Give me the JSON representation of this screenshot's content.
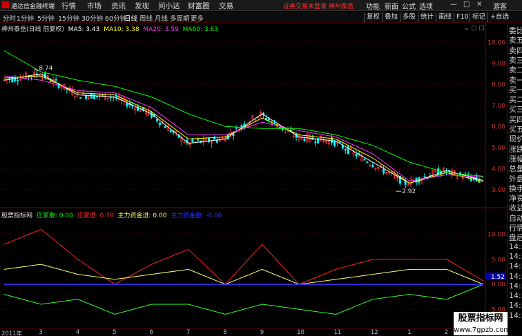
{
  "menubar": {
    "app_title": "通达信金融终端",
    "items": [
      "行情",
      "市场",
      "资讯",
      "发现",
      "问小达",
      "财富圈",
      "交易"
    ],
    "notice": "证券交易未登录  神州泰岳",
    "right_items": [
      "功能",
      "新面",
      "公式",
      "选项"
    ],
    "user": "游客"
  },
  "toolbar": {
    "periods": [
      "分时",
      "1分钟",
      "5分钟",
      "15分钟",
      "30分钟",
      "60分钟",
      "日线",
      "周线",
      "月线",
      "多周期",
      "更多"
    ],
    "active_period": "日线",
    "buttons": [
      "复权",
      "叠加",
      "多股",
      "统计",
      "画线",
      "F10",
      "标记",
      "+自选"
    ]
  },
  "kline": {
    "title": "神州泰岳(日线 前复权)",
    "ma": [
      {
        "label": "MA5: 3.43",
        "color": "#ffffff"
      },
      {
        "label": "MA10: 3.38",
        "color": "#ffff00"
      },
      {
        "label": "MA20: 3.59",
        "color": "#ff33ff"
      },
      {
        "label": "MA60: 3.63",
        "color": "#00ff00"
      }
    ],
    "high_label": "8.74",
    "low_label": "2.92",
    "y_labels": [
      "10.00",
      "9.00",
      "8.00",
      "7.00",
      "6.00",
      "5.00",
      "4.00",
      "3.00"
    ]
  },
  "indicator": {
    "title": "股票指标网",
    "items": [
      {
        "label": "庄家散: 0.00",
        "color": "#00ff00"
      },
      {
        "label": "庄家进: 0.70",
        "color": "#ff3333"
      },
      {
        "label": "主力资金进: 0.00",
        "color": "#ffff66"
      },
      {
        "label": "主力资金散: -0.06",
        "color": "#3333ff"
      }
    ],
    "y_labels": [
      "10.00",
      "5.00",
      "0.00",
      "-5.00"
    ],
    "current_value": "1.52"
  },
  "right_panel": [
    "委比",
    "卖五",
    "卖四",
    "卖三",
    "卖二",
    "卖一",
    "买一",
    "买二",
    "买三",
    "买四",
    "买五",
    "现价",
    "涨跌",
    "涨幅",
    "总量",
    "外盘",
    "换手",
    "净资",
    "收益",
    "自动",
    "行情",
    "盘后",
    "14:56",
    "14:56",
    "14:56",
    "14:56",
    "14:56",
    "14:56",
    "14:56",
    "14:56"
  ],
  "x_axis": [
    "2011年",
    "3",
    "4",
    "5",
    "6",
    "7",
    "8",
    "9",
    "10",
    "11",
    "12",
    "1",
    "2",
    "3"
  ],
  "watermark": {
    "title": "股票指标网",
    "url": "www.7gpzb.com"
  },
  "colors": {
    "up": "#ff3333",
    "down": "#00ffff",
    "ma5": "#ffffff",
    "ma10": "#ffff00",
    "ma20": "#ff33ff",
    "ma60": "#00ff00",
    "ind_red": "#ff2222",
    "ind_green": "#33ff33",
    "ind_yellow": "#ffff66",
    "ind_blue": "#3333ff"
  },
  "chart_data": [
    {
      "type": "line",
      "title": "神州泰岳(日线 前复权)",
      "ylim": [
        2.5,
        10.5
      ],
      "y_ticks": [
        10,
        9,
        8,
        7,
        6,
        5,
        4,
        3
      ],
      "x": [
        "2011年",
        "3",
        "4",
        "5",
        "6",
        "7",
        "8",
        "9",
        "10",
        "11",
        "12",
        "1",
        "2",
        "3"
      ],
      "series": [
        {
          "name": "MA5",
          "values": [
            8.2,
            8.5,
            7.5,
            7.4,
            6.6,
            5.2,
            5.4,
            6.6,
            5.5,
            5.3,
            4.3,
            3.3,
            3.9,
            3.43
          ]
        },
        {
          "name": "MA10",
          "values": [
            8.3,
            8.4,
            7.6,
            7.5,
            6.7,
            5.4,
            5.5,
            6.4,
            5.6,
            5.4,
            4.5,
            3.3,
            3.8,
            3.38
          ]
        },
        {
          "name": "MA20",
          "values": [
            8.4,
            8.2,
            7.7,
            7.6,
            6.9,
            5.6,
            5.6,
            6.2,
            5.8,
            5.5,
            4.7,
            3.4,
            3.7,
            3.59
          ]
        },
        {
          "name": "MA60",
          "values": [
            9.6,
            8.6,
            8.2,
            7.9,
            7.4,
            6.6,
            6.0,
            5.9,
            5.9,
            5.6,
            5.1,
            4.3,
            3.8,
            3.63
          ]
        }
      ],
      "annotations": [
        {
          "text": "8.74",
          "y": 8.74
        },
        {
          "text": "2.92",
          "y": 2.92
        }
      ]
    },
    {
      "type": "line",
      "title": "股票指标网",
      "ylim": [
        -8,
        13
      ],
      "y_ticks": [
        10,
        5,
        0,
        -5
      ],
      "x": [
        "2011年",
        "3",
        "4",
        "5",
        "6",
        "7",
        "8",
        "9",
        "10",
        "11",
        "12",
        "1",
        "2",
        "3"
      ],
      "series": [
        {
          "name": "庄家进",
          "values": [
            8,
            11,
            5,
            0,
            4,
            7,
            0,
            8,
            0,
            3,
            5,
            5,
            5,
            0.7
          ]
        },
        {
          "name": "庄家散",
          "values": [
            -2,
            -4,
            -3,
            -6,
            -4,
            -4,
            -6,
            -4,
            -5,
            -6,
            -3,
            -2,
            -3,
            0
          ]
        },
        {
          "name": "主力资金进",
          "values": [
            3,
            4,
            2,
            1,
            2,
            3,
            0,
            3,
            0,
            1,
            2,
            3,
            3,
            0
          ]
        },
        {
          "name": "主力资金散",
          "values": [
            0,
            0,
            0,
            0,
            0,
            0,
            0,
            0,
            0,
            0,
            0,
            0,
            0,
            -0.06
          ]
        }
      ]
    }
  ]
}
